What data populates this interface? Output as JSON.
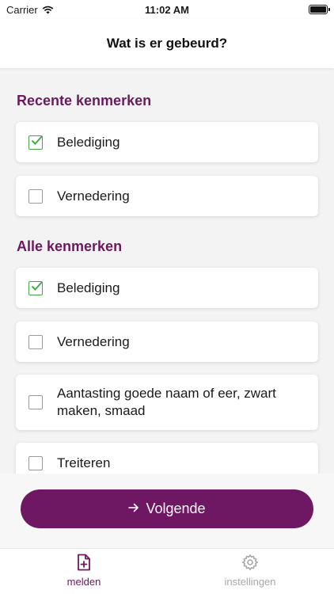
{
  "status_bar": {
    "carrier": "Carrier",
    "time": "11:02 AM"
  },
  "nav": {
    "title": "Wat is er gebeurd?"
  },
  "recent": {
    "title": "Recente kenmerken",
    "items": [
      {
        "label": "Belediging",
        "checked": true
      },
      {
        "label": "Vernedering",
        "checked": false
      }
    ]
  },
  "all": {
    "title": "Alle kenmerken",
    "items": [
      {
        "label": "Belediging",
        "checked": true
      },
      {
        "label": "Vernedering",
        "checked": false
      },
      {
        "label": "Aantasting goede naam of eer, zwart maken, smaad",
        "checked": false
      },
      {
        "label": "Treiteren",
        "checked": false
      }
    ]
  },
  "primary_button": {
    "label": "Volgende",
    "icon": "arrow-right-icon"
  },
  "tabs": [
    {
      "label": "melden",
      "icon": "file-plus-icon",
      "active": true
    },
    {
      "label": "instellingen",
      "icon": "gear-icon",
      "active": false
    }
  ],
  "colors": {
    "accent": "#6e1762",
    "section_title": "#6b1a60",
    "check": "#48a848",
    "inactive_tab": "#a8a8a8"
  }
}
